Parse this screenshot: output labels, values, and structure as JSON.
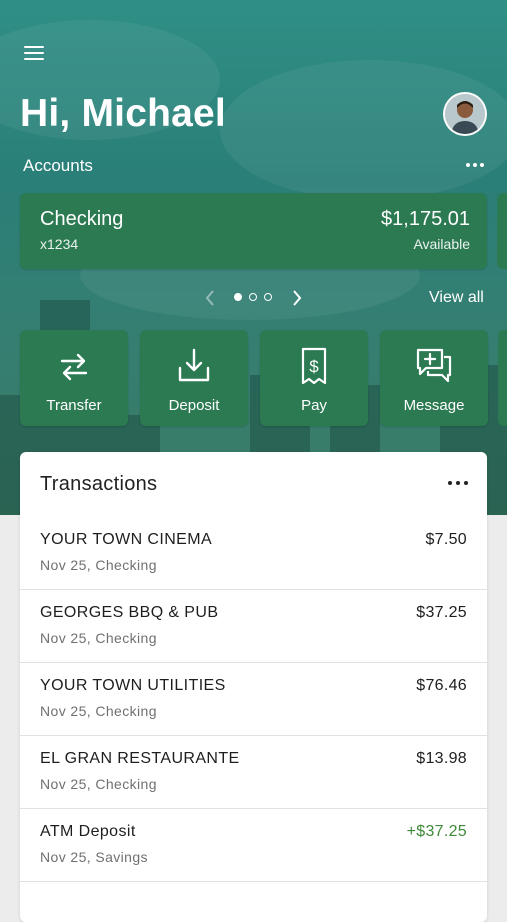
{
  "header": {
    "greeting": "Hi, Michael"
  },
  "accounts": {
    "label": "Accounts",
    "card": {
      "name": "Checking",
      "number": "x1234",
      "balance": "$1,175.01",
      "balance_label": "Available"
    },
    "pager": {
      "pages": 3,
      "current": 1,
      "prev_icon": "chevron-left-icon",
      "next_icon": "chevron-right-icon"
    },
    "view_all": "View all"
  },
  "actions": [
    {
      "label": "Transfer",
      "icon": "transfer-arrows-icon"
    },
    {
      "label": "Deposit",
      "icon": "download-tray-icon"
    },
    {
      "label": "Pay",
      "icon": "receipt-dollar-icon"
    },
    {
      "label": "Message",
      "icon": "chat-plus-icon"
    }
  ],
  "transactions": {
    "title": "Transactions",
    "items": [
      {
        "name": "YOUR TOWN CINEMA",
        "sub": "Nov 25, Checking",
        "amount": "$7.50",
        "positive": false
      },
      {
        "name": "GEORGES BBQ & PUB",
        "sub": "Nov 25, Checking",
        "amount": "$37.25",
        "positive": false
      },
      {
        "name": "YOUR TOWN UTILITIES",
        "sub": "Nov 25, Checking",
        "amount": "$76.46",
        "positive": false
      },
      {
        "name": "EL GRAN RESTAURANTE",
        "sub": "Nov 25, Checking",
        "amount": "$13.98",
        "positive": false
      },
      {
        "name": "ATM Deposit",
        "sub": "Nov 25, Savings",
        "amount": "+$37.25",
        "positive": true
      }
    ]
  },
  "colors": {
    "card_green": "#2b7a52",
    "hero_teal": "#2a7f78",
    "positive_green": "#3e8a3a",
    "background": "#ececec"
  }
}
